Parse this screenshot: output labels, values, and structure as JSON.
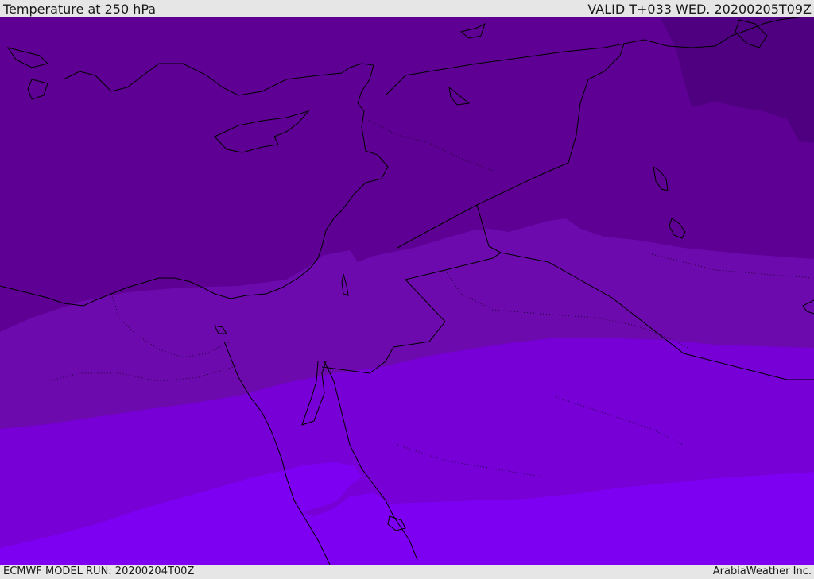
{
  "header": {
    "title": "Temperature at 250 hPa",
    "valid": "VALID T+033 WED. 20200205T09Z"
  },
  "footer": {
    "model_run": "ECMWF MODEL RUN: 20200204T00Z",
    "credit": "ArabiaWeather Inc."
  },
  "map": {
    "field": "temperature",
    "level": "250 hPa",
    "shading": {
      "band_1": "#4f0080",
      "band_2": "#5e0094",
      "band_3": "#6c0aad",
      "band_4": "#7600d6",
      "band_5": "#7d00f2"
    },
    "coastline_color": "#000000",
    "border_style": "dotted"
  }
}
